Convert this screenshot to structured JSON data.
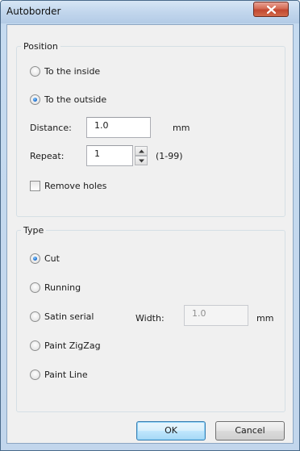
{
  "window": {
    "title": "Autoborder",
    "close_icon": "close-icon"
  },
  "position": {
    "legend": "Position",
    "inside_label": "To the inside",
    "outside_label": "To the outside",
    "selected": "outside",
    "distance_label": "Distance:",
    "distance_value": "1.0",
    "distance_unit": "mm",
    "repeat_label": "Repeat:",
    "repeat_value": "1",
    "repeat_range": "(1-99)",
    "remove_holes_label": "Remove holes",
    "remove_holes_checked": false
  },
  "type": {
    "legend": "Type",
    "options": [
      "Cut",
      "Running",
      "Satin serial",
      "Paint ZigZag",
      "Paint Line"
    ],
    "selected": "Cut",
    "width_label": "Width:",
    "width_value": "1.0",
    "width_unit": "mm"
  },
  "buttons": {
    "ok_label": "OK",
    "cancel_label": "Cancel"
  }
}
